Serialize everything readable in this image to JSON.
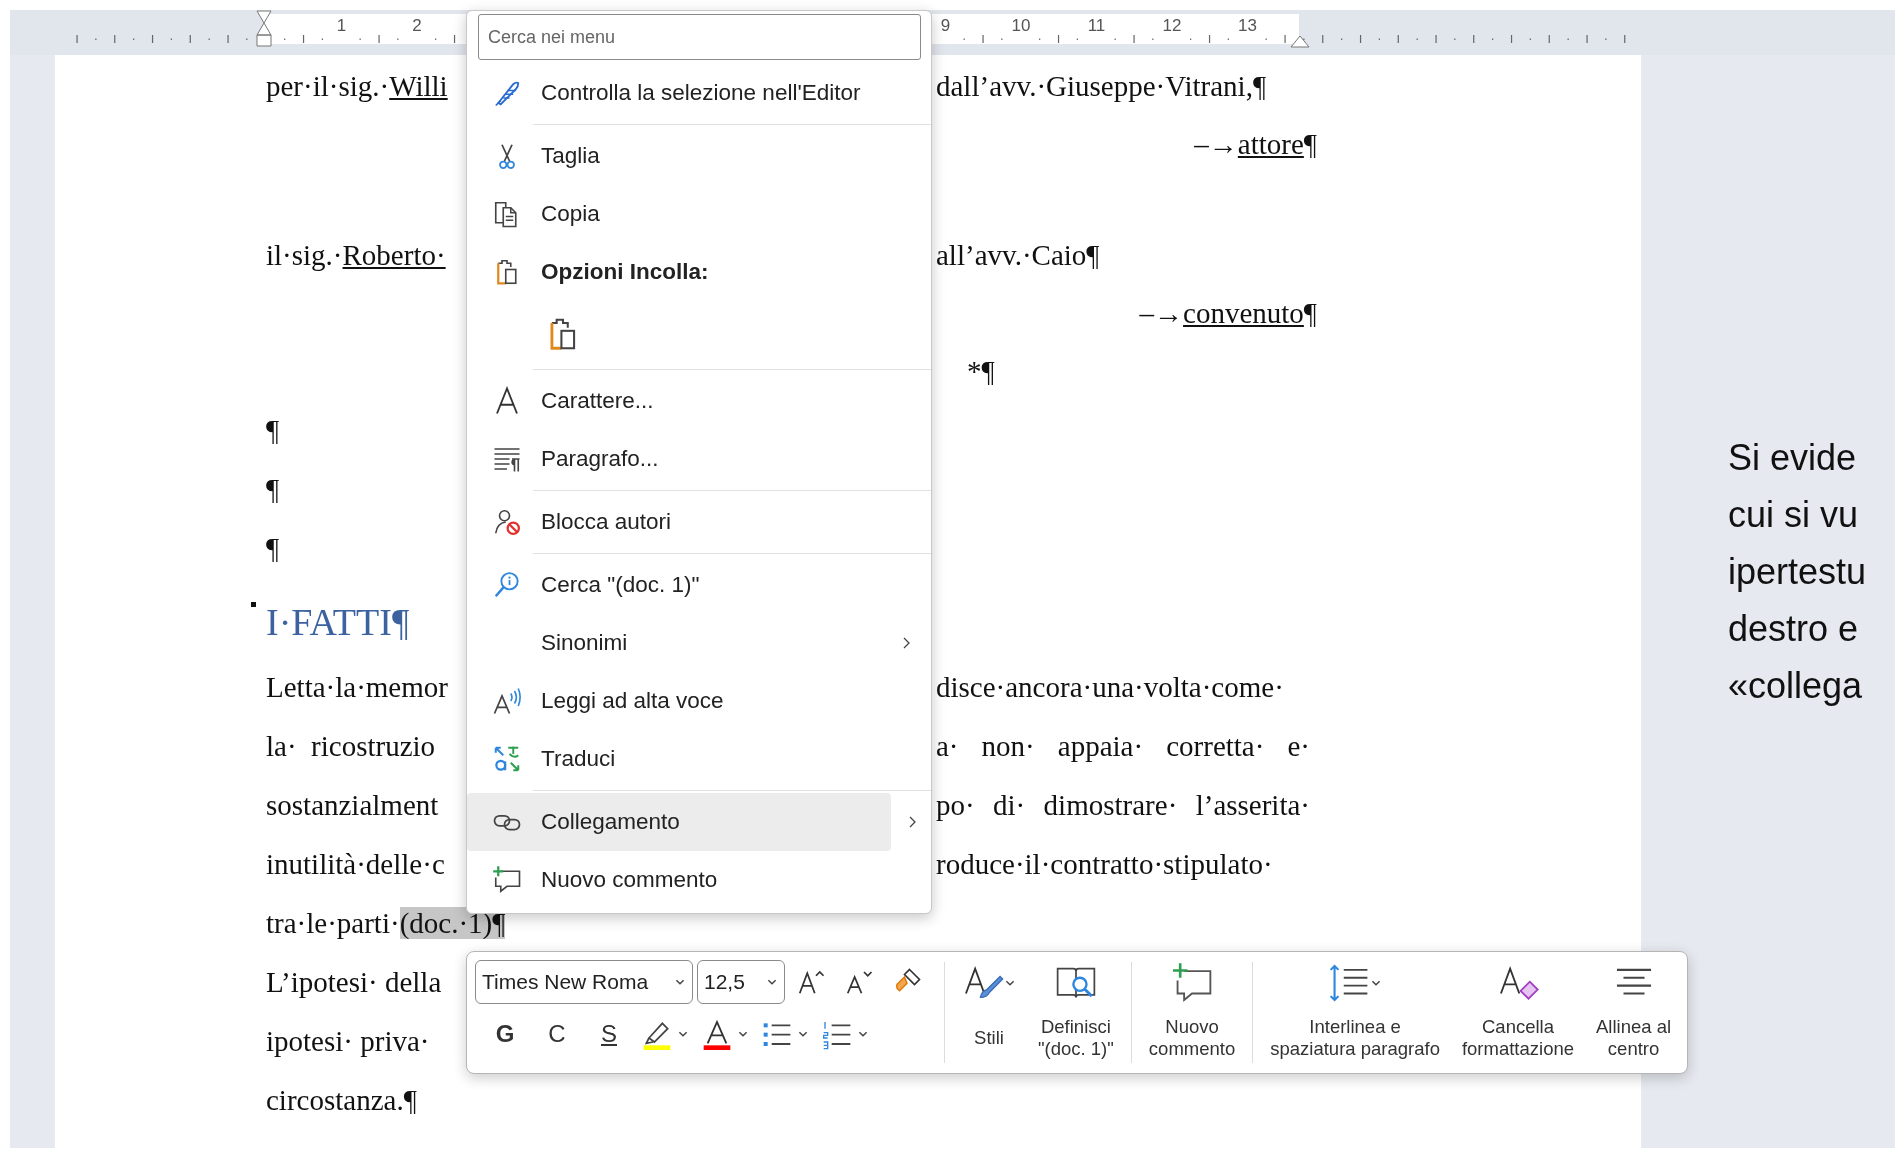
{
  "ruler": {
    "left_numbers": [
      "1",
      "2"
    ],
    "right_numbers": [
      "9",
      "10",
      "11",
      "12",
      "13"
    ]
  },
  "document": {
    "parties": [
      {
        "lines": [
          {
            "kind": "split",
            "left": [
              {
                "text": "per·il·sig.·",
                "kind": "plain"
              },
              {
                "text": "Willi",
                "kind": "underlined"
              }
            ],
            "right": [
              {
                "text": "dall’avv.·Giuseppe·Vitrani,¶",
                "kind": "plain"
              }
            ]
          },
          {
            "kind": "tabbed",
            "right": [
              {
                "text": "–→",
                "kind": "plain"
              },
              {
                "text": "attore",
                "kind": "underlined"
              },
              {
                "text": "¶",
                "kind": "plain"
              }
            ]
          }
        ]
      },
      {
        "lines": [
          {
            "kind": "split",
            "left": [
              {
                "text": "il·sig.·",
                "kind": "plain"
              },
              {
                "text": "Roberto·",
                "kind": "underlined"
              }
            ],
            "right": [
              {
                "text": "all’avv.·Caio¶",
                "kind": "plain"
              }
            ]
          },
          {
            "kind": "tabbed",
            "right": [
              {
                "text": "–→",
                "kind": "plain"
              },
              {
                "text": "convenuto",
                "kind": "underlined"
              },
              {
                "text": "¶",
                "kind": "plain"
              }
            ]
          }
        ]
      }
    ],
    "body": [
      {
        "kind": "indented",
        "right": [
          {
            "text": "*¶",
            "kind": "plain"
          }
        ]
      },
      {
        "kind": "split",
        "left": [
          {
            "text": "¶",
            "kind": "plain"
          }
        ]
      },
      {
        "kind": "split",
        "left": [
          {
            "text": "¶",
            "kind": "plain"
          }
        ]
      },
      {
        "kind": "split",
        "left": [
          {
            "text": "¶",
            "kind": "plain"
          }
        ]
      },
      {
        "kind": "heading",
        "text": "I·FATTI¶"
      },
      {
        "kind": "justified",
        "left": [
          {
            "text": "Letta·la·memor",
            "kind": "plain"
          }
        ],
        "right": [
          {
            "text": "disce·ancora·una·volta·come·",
            "kind": "plain"
          }
        ]
      },
      {
        "kind": "justified",
        "left": [
          {
            "text": "la·  ricostruzio",
            "kind": "plain"
          }
        ],
        "right": [
          {
            "text": "a· non· appaia· corretta· e·",
            "kind": "plain"
          }
        ]
      },
      {
        "kind": "justified",
        "left": [
          {
            "text": "sostanzialment",
            "kind": "plain"
          }
        ],
        "right": [
          {
            "text": "po· di· dimostrare· l’asserita·",
            "kind": "plain"
          }
        ]
      },
      {
        "kind": "justified",
        "left": [
          {
            "text": "inutilità·delle·c",
            "kind": "plain"
          }
        ],
        "right": [
          {
            "text": "roduce·il·contratto·stipulato·",
            "kind": "plain"
          }
        ]
      },
      {
        "kind": "split",
        "left": [
          {
            "text": "tra·le·parti·",
            "kind": "plain"
          },
          {
            "text": "(doc.·1)¶",
            "kind": "selected"
          }
        ]
      },
      {
        "kind": "split",
        "left": [
          {
            "text": "L’ipotesi· della",
            "kind": "plain"
          }
        ]
      },
      {
        "kind": "split",
        "left": [
          {
            "text": "ipotesi· priva·",
            "kind": "plain"
          }
        ]
      },
      {
        "kind": "split",
        "left": [
          {
            "text": "circostanza.¶",
            "kind": "plain"
          }
        ]
      }
    ]
  },
  "side_note": {
    "lines": [
      "Si evide",
      "cui si vu",
      "ipertestu",
      "destro e",
      "«collega"
    ]
  },
  "context_menu": {
    "search": {
      "placeholder": "Cerca nei menu"
    },
    "items": [
      {
        "kind": "editor",
        "label": "Controlla la selezione nell'Editor",
        "submenu": false,
        "selected": false
      },
      {
        "kind": "separator"
      },
      {
        "kind": "cut",
        "label": "Taglia",
        "submenu": false,
        "selected": false
      },
      {
        "kind": "copy",
        "label": "Copia",
        "submenu": false,
        "selected": false
      },
      {
        "kind": "paste-header",
        "label": "Opzioni Incolla:"
      },
      {
        "kind": "paste-option",
        "submenu": false,
        "selected": false
      },
      {
        "kind": "separator"
      },
      {
        "kind": "font",
        "label": "Carattere...",
        "submenu": false,
        "selected": false
      },
      {
        "kind": "paragraph",
        "label": "Paragrafo...",
        "submenu": false,
        "selected": false
      },
      {
        "kind": "separator"
      },
      {
        "kind": "block-authors",
        "label": "Blocca autori",
        "submenu": false,
        "selected": false
      },
      {
        "kind": "separator"
      },
      {
        "kind": "search",
        "label": "Cerca \"(doc. 1)\"",
        "submenu": false,
        "selected": false
      },
      {
        "kind": "synonyms",
        "label": "Sinonimi",
        "submenu": true,
        "selected": false
      },
      {
        "kind": "read-aloud",
        "label": "Leggi ad alta voce",
        "submenu": false,
        "selected": false
      },
      {
        "kind": "translate",
        "label": "Traduci",
        "submenu": false,
        "selected": false
      },
      {
        "kind": "separator"
      },
      {
        "kind": "link",
        "label": "Collegamento",
        "submenu": true,
        "selected": true
      },
      {
        "kind": "comment",
        "label": "Nuovo commento",
        "submenu": false,
        "selected": false
      }
    ]
  },
  "mini_toolbar": {
    "font_name": "Times New Roma",
    "font_size": "12,5",
    "quick_buttons": [
      {
        "kind": "grow-font"
      },
      {
        "kind": "shrink-font"
      },
      {
        "kind": "format-painter"
      }
    ],
    "format_buttons": [
      {
        "kind": "bold",
        "label": "G",
        "dropdown": false
      },
      {
        "kind": "italic",
        "label": "C",
        "dropdown": false
      },
      {
        "kind": "underline",
        "label": "S",
        "dropdown": false
      },
      {
        "kind": "highlight",
        "color": "#ffff00",
        "dropdown": true
      },
      {
        "kind": "font-color",
        "color": "#ff0000",
        "dropdown": true
      },
      {
        "kind": "bullets",
        "dropdown": true
      },
      {
        "kind": "numbering",
        "dropdown": true
      }
    ],
    "groups": [
      [
        {
          "kind": "styles",
          "lines": [
            "Stili"
          ],
          "dropdown": true
        },
        {
          "kind": "define",
          "lines": [
            "Definisci",
            "\"(doc. 1)\""
          ],
          "dropdown": false
        }
      ],
      [
        {
          "kind": "comment",
          "lines": [
            "Nuovo",
            "commento"
          ],
          "dropdown": false
        }
      ],
      [
        {
          "kind": "spacing",
          "lines": [
            "Interlinea e",
            "spaziatura paragrafo"
          ],
          "dropdown": true
        },
        {
          "kind": "clear",
          "lines": [
            "Cancella",
            "formattazione"
          ],
          "dropdown": false
        },
        {
          "kind": "align-center",
          "lines": [
            "Allinea al",
            "centro"
          ],
          "dropdown": false
        }
      ]
    ]
  }
}
